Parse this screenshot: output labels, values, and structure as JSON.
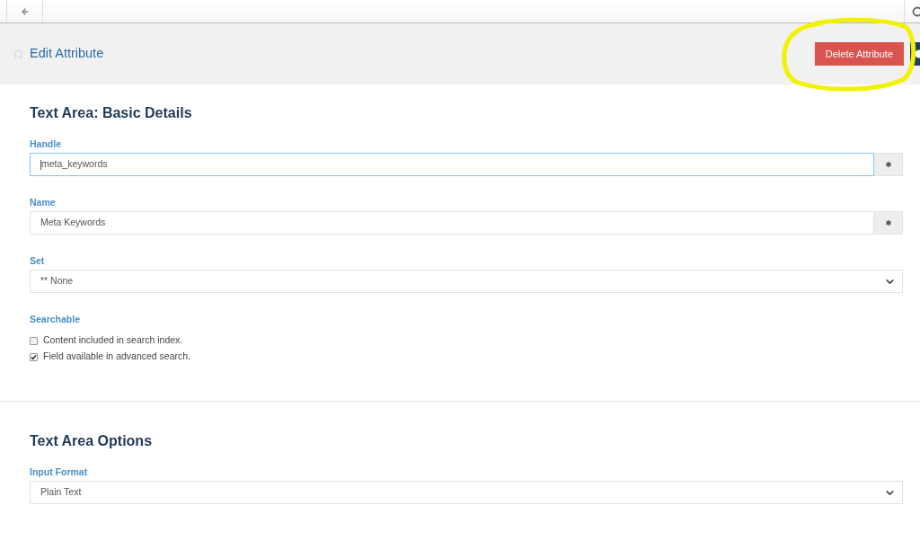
{
  "header": {
    "title": "Edit Attribute",
    "delete_button": "Delete Attribute"
  },
  "sections": [
    {
      "title": "Text Area: Basic Details",
      "fields": [
        {
          "kind": "text",
          "label": "Handle",
          "value": "meta_keywords",
          "focused": true,
          "required": true
        },
        {
          "kind": "text",
          "label": "Name",
          "value": "Meta Keywords",
          "focused": false,
          "required": true
        },
        {
          "kind": "select",
          "label": "Set",
          "value": "** None"
        },
        {
          "kind": "checkboxes",
          "label": "Searchable",
          "options": [
            {
              "label": "Content included in search index.",
              "checked": false
            },
            {
              "label": "Field available in advanced search.",
              "checked": true
            }
          ]
        }
      ]
    },
    {
      "title": "Text Area Options",
      "fields": [
        {
          "kind": "select",
          "label": "Input Format",
          "value": "Plain Text"
        }
      ]
    }
  ]
}
